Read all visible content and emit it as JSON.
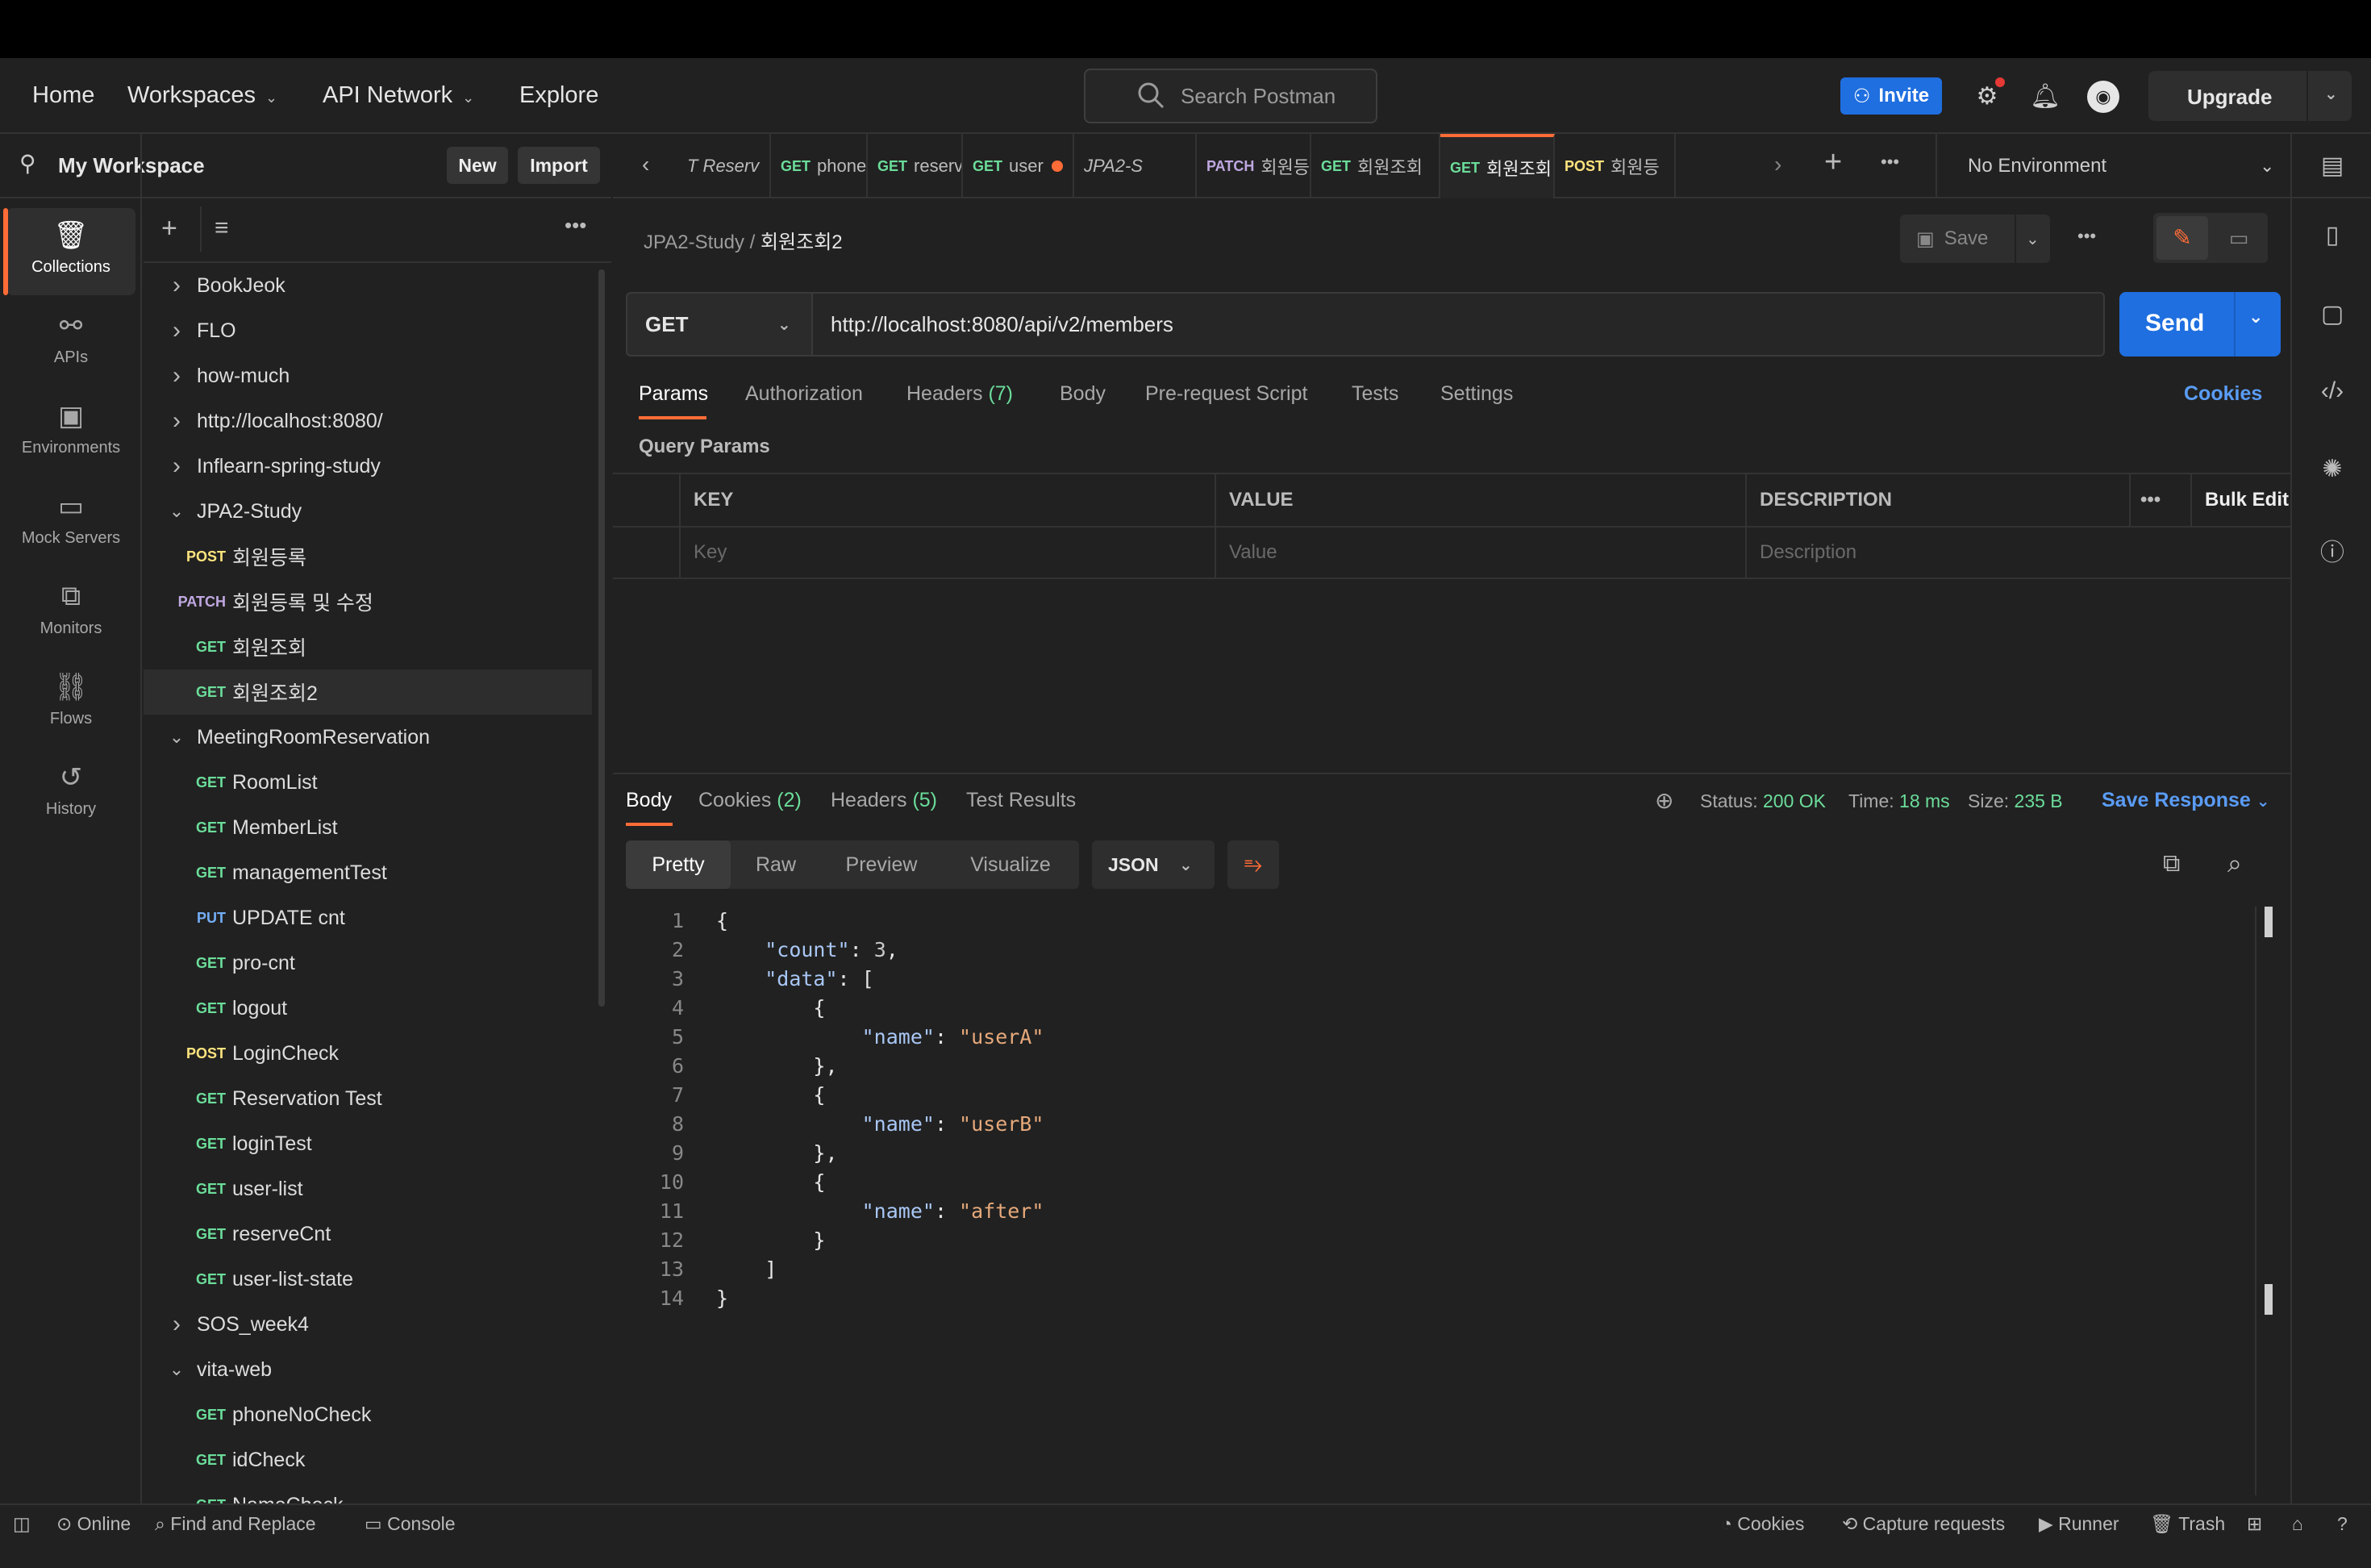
{
  "nav": {
    "home": "Home",
    "workspaces": "Workspaces",
    "api_network": "API Network",
    "explore": "Explore",
    "search_placeholder": "Search Postman",
    "invite": "Invite",
    "upgrade": "Upgrade"
  },
  "workspace": {
    "name": "My Workspace",
    "new": "New",
    "import": "Import"
  },
  "rail": [
    "Collections",
    "APIs",
    "Environments",
    "Mock Servers",
    "Monitors",
    "Flows",
    "History"
  ],
  "tree": [
    {
      "type": "folder",
      "open": false,
      "label": "BookJeok"
    },
    {
      "type": "folder",
      "open": false,
      "label": "FLO"
    },
    {
      "type": "folder",
      "open": false,
      "label": "how-much"
    },
    {
      "type": "folder",
      "open": false,
      "label": "http://localhost:8080/"
    },
    {
      "type": "folder",
      "open": false,
      "label": "Inflearn-spring-study"
    },
    {
      "type": "folder",
      "open": true,
      "label": "JPA2-Study"
    },
    {
      "type": "req",
      "method": "POST",
      "label": "회원등록"
    },
    {
      "type": "req",
      "method": "PATCH",
      "label": "회원등록 및 수정"
    },
    {
      "type": "req",
      "method": "GET",
      "label": "회원조회"
    },
    {
      "type": "req",
      "method": "GET",
      "label": "회원조회2",
      "selected": true
    },
    {
      "type": "folder",
      "open": true,
      "label": "MeetingRoomReservation"
    },
    {
      "type": "req",
      "method": "GET",
      "label": "RoomList"
    },
    {
      "type": "req",
      "method": "GET",
      "label": "MemberList"
    },
    {
      "type": "req",
      "method": "GET",
      "label": "managementTest"
    },
    {
      "type": "req",
      "method": "PUT",
      "label": "UPDATE cnt"
    },
    {
      "type": "req",
      "method": "GET",
      "label": "pro-cnt"
    },
    {
      "type": "req",
      "method": "GET",
      "label": "logout"
    },
    {
      "type": "req",
      "method": "POST",
      "label": "LoginCheck"
    },
    {
      "type": "req",
      "method": "GET",
      "label": "Reservation Test"
    },
    {
      "type": "req",
      "method": "GET",
      "label": "loginTest"
    },
    {
      "type": "req",
      "method": "GET",
      "label": "user-list"
    },
    {
      "type": "req",
      "method": "GET",
      "label": "reserveCnt"
    },
    {
      "type": "req",
      "method": "GET",
      "label": "user-list-state"
    },
    {
      "type": "folder",
      "open": false,
      "label": "SOS_week4"
    },
    {
      "type": "folder",
      "open": true,
      "label": "vita-web"
    },
    {
      "type": "req",
      "method": "GET",
      "label": "phoneNoCheck"
    },
    {
      "type": "req",
      "method": "GET",
      "label": "idCheck"
    },
    {
      "type": "req",
      "method": "GET",
      "label": "NameCheck"
    }
  ],
  "tabs": [
    {
      "method": "",
      "label": "T Reserv"
    },
    {
      "method": "GET",
      "label": "phoneN"
    },
    {
      "method": "GET",
      "label": "reserve"
    },
    {
      "method": "GET",
      "label": "user",
      "dot": true
    },
    {
      "method": "",
      "label": "JPA2-S"
    },
    {
      "method": "PATCH",
      "label": "회원등"
    },
    {
      "method": "GET",
      "label": "회원조회"
    },
    {
      "method": "GET",
      "label": "회원조회",
      "active": true
    },
    {
      "method": "POST",
      "label": "회원등"
    }
  ],
  "environment": "No Environment",
  "breadcrumb": {
    "collection": "JPA2-Study",
    "sep": "/",
    "request": "회원조회2"
  },
  "save": "Save",
  "request": {
    "method": "GET",
    "url": "http://localhost:8080/api/v2/members",
    "send": "Send"
  },
  "req_tabs": {
    "params": "Params",
    "authorization": "Authorization",
    "headers": "Headers",
    "headers_count": "(7)",
    "body": "Body",
    "prerequest": "Pre-request Script",
    "tests": "Tests",
    "settings": "Settings",
    "cookies": "Cookies"
  },
  "query_params": {
    "title": "Query Params",
    "key": "KEY",
    "value": "VALUE",
    "description": "DESCRIPTION",
    "bulk_edit": "Bulk Edit",
    "key_ph": "Key",
    "value_ph": "Value",
    "desc_ph": "Description"
  },
  "response": {
    "body": "Body",
    "cookies": "Cookies",
    "cookies_count": "(2)",
    "headers": "Headers",
    "headers_count": "(5)",
    "test_results": "Test Results",
    "status_label": "Status:",
    "status": "200 OK",
    "time_label": "Time:",
    "time": "18 ms",
    "size_label": "Size:",
    "size": "235 B",
    "save_response": "Save Response"
  },
  "view": {
    "pretty": "Pretty",
    "raw": "Raw",
    "preview": "Preview",
    "visualize": "Visualize",
    "format": "JSON"
  },
  "code_lines": [
    "{",
    "    \"count\": 3,",
    "    \"data\": [",
    "        {",
    "            \"name\": \"userA\"",
    "        },",
    "        {",
    "            \"name\": \"userB\"",
    "        },",
    "        {",
    "            \"name\": \"after\"",
    "        }",
    "    ]",
    "}"
  ],
  "footer": {
    "online": "Online",
    "find": "Find and Replace",
    "console": "Console",
    "cookies": "Cookies",
    "capture": "Capture requests",
    "runner": "Runner",
    "trash": "Trash"
  }
}
